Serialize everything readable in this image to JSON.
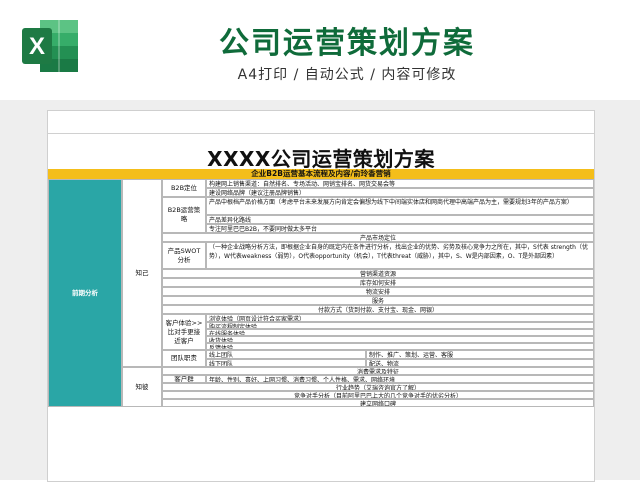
{
  "header": {
    "logo_letter": "X",
    "title": "公司运营策划方案",
    "subtitle": "A4打印 / 自动公式 / 内容可修改"
  },
  "sheet": {
    "title": "XXXX公司运营策划方案",
    "bar": "企业B2B运营基本流程及内容/俞玲香营销",
    "section": "前期分析",
    "know_self": "知己",
    "know_other": "知彼",
    "rows": {
      "b2b_pos": "B2B定位",
      "b2b_pos_1": "构建网上销售渠道：自然排名、专场活动、网销宝排名、网货交易会等",
      "b2b_pos_2": "建设网络品牌（建议注册品牌销售）",
      "b2b_strategy": "B2B运营策略",
      "b2b_strat_1": "产品中根档产品价格方面（考虑平台未来发展方向肯定会偏想为线下中间端实体店和网商代理中高端产品为主，需要规划3年的产品方案）",
      "b2b_strat_2": "产品差异化路线",
      "b2b_strat_3": "专注阿里巴巴B2B，不要同时做太多平台",
      "market_env": "产品市场定位",
      "swot_label": "产品SWOT分析",
      "swot_text": "（一种企业战略分析方法，即根据企业自身的既定内在条件进行分析，找出企业的优势、劣势及核心竞争力之所在，其中，S代表 strength（优势），W代表weakness（弱势），O代表opportunity（机会），T代表threat（威胁），其中，S、W是内部因素，O、T是外部因素）",
      "channel": "营销渠道资源",
      "stock": "库存如何安排",
      "logistics": "物流安排",
      "service": "服务",
      "payment": "付款方式（货到付款、支付宝、现金、网银）",
      "cx_label": "客户体验>>比对手更接近客户",
      "cx_1": "浏览体验（网页设计符合买家需求）",
      "cx_2": "购买流程制定体验",
      "cx_3": "在线服务体验",
      "cx_4": "收货体验",
      "cx_5": "反馈体验",
      "team_label": "团队职责",
      "team_1": "线上团队",
      "team_2": "线下团队",
      "team_1_r": "制作、推广、策划、运营、客服",
      "team_2_r": "配送、物流",
      "demand": "消费需求及特征",
      "group_label": "客户群",
      "group_text": "年龄、性别、喜好、上网习惯、消费习惯、个人性格、需求、网络环境",
      "trend": "行业趋势（艾瑞咨询官方了解）",
      "rival": "竞争对手分析（目前阿里巴巴上大的几个竞争对手的优劣分析）",
      "build": "建立网络口碑"
    }
  },
  "colors": {
    "brand_green": "#0f6b3a",
    "teal": "#2aa6a6",
    "yellow": "#f4be1a"
  }
}
